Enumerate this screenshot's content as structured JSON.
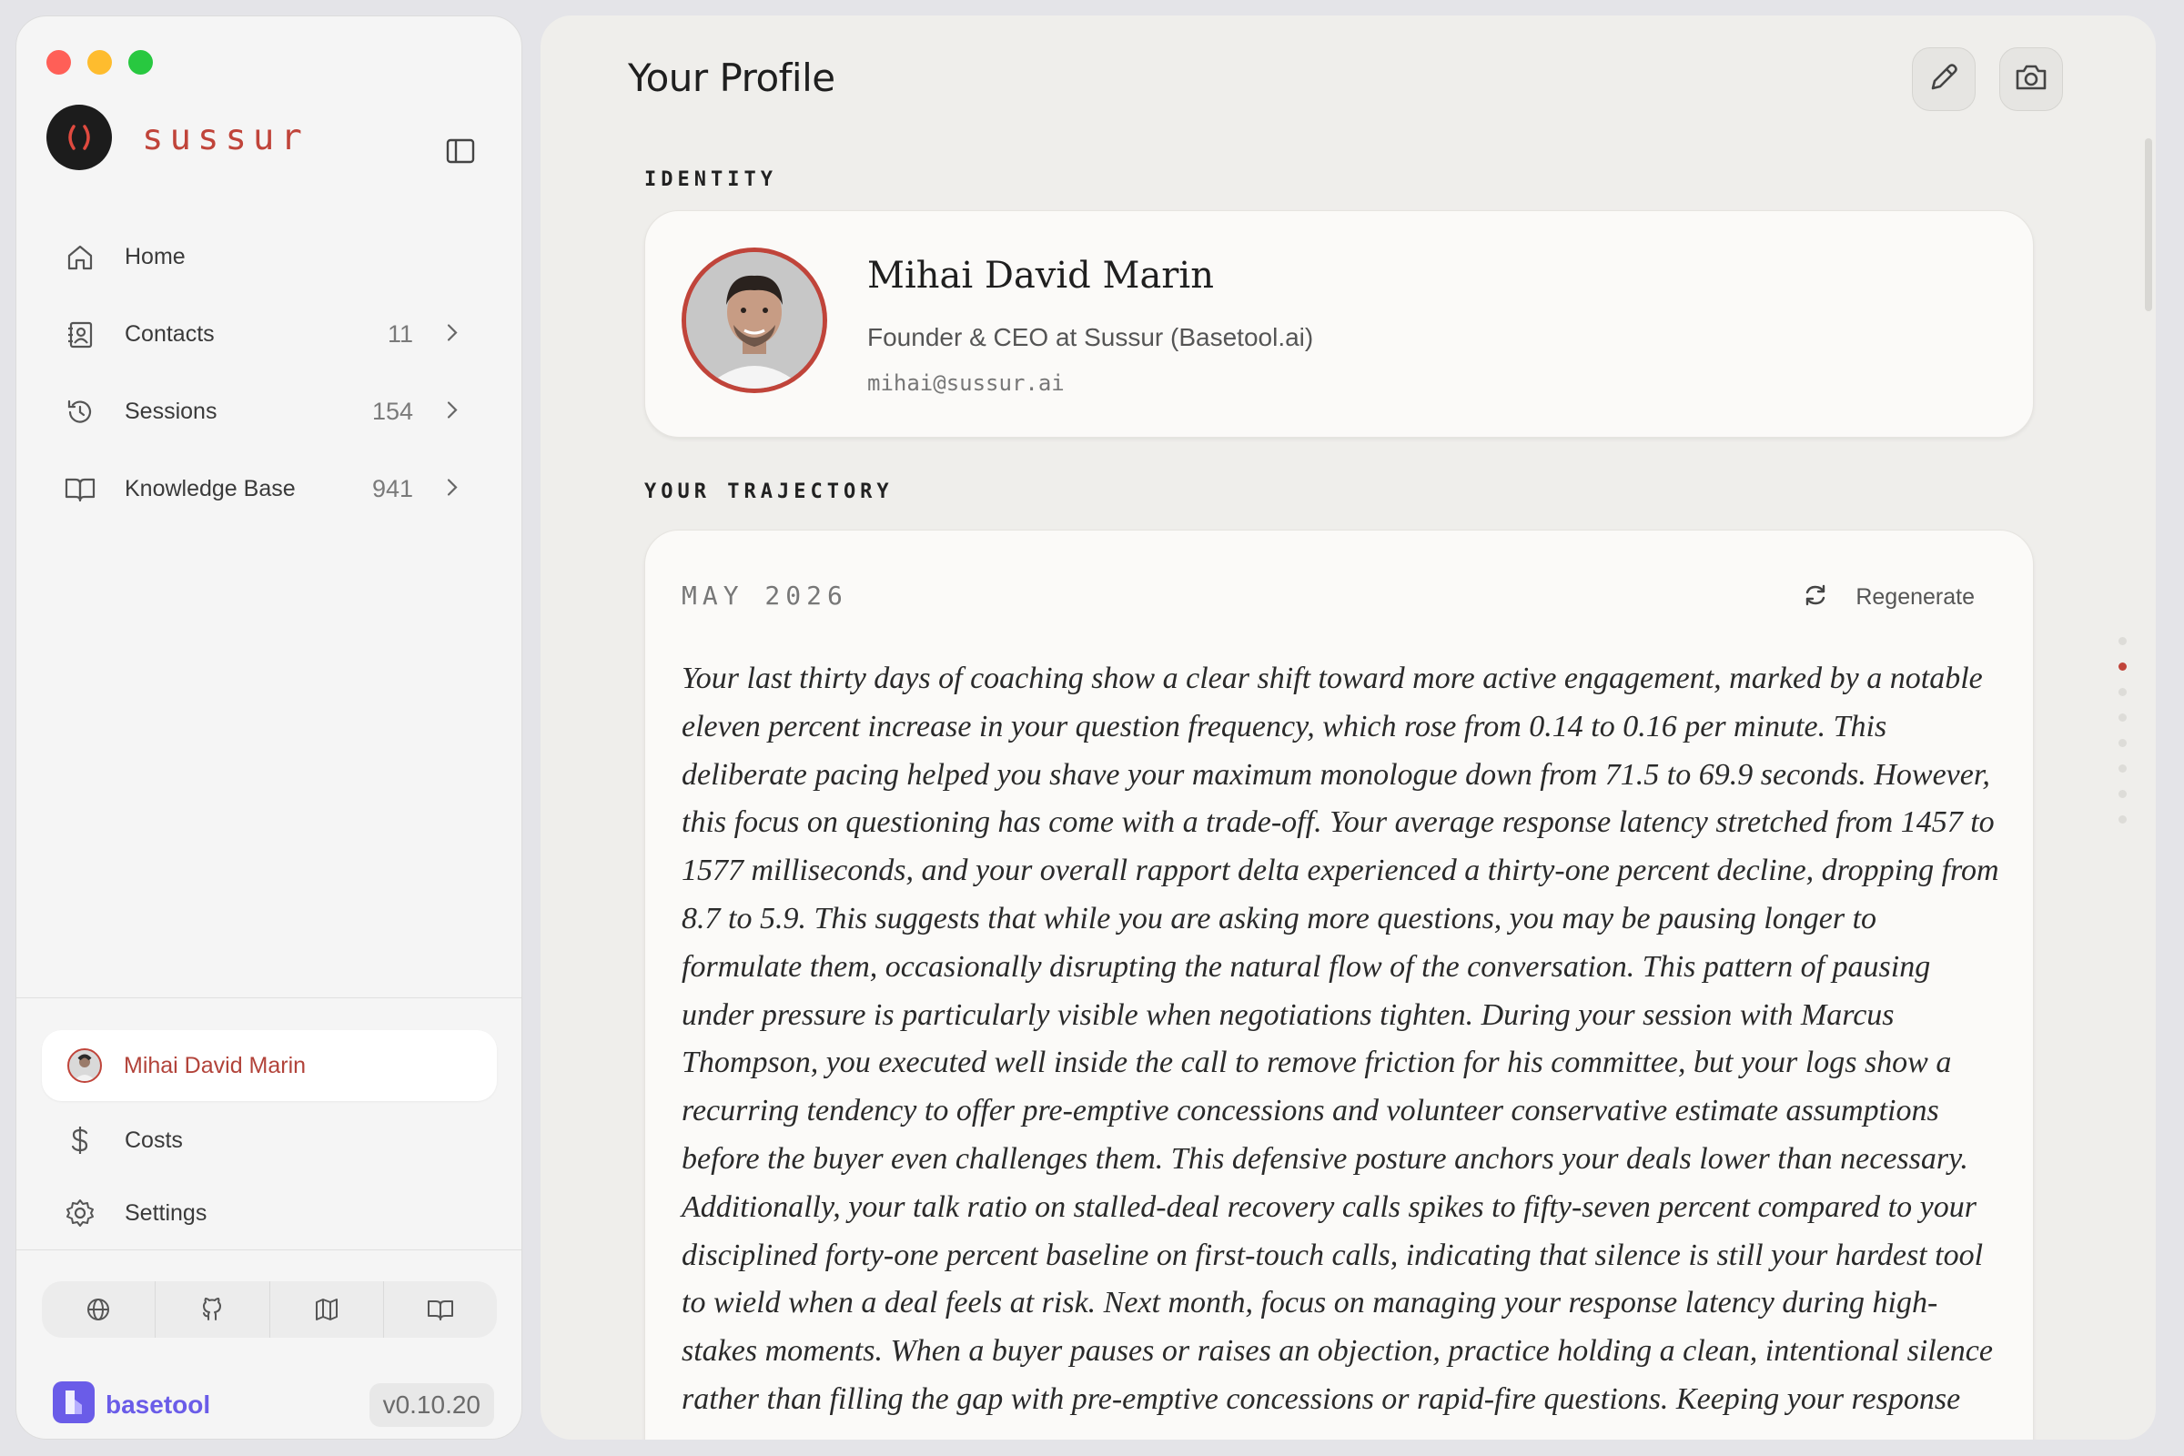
{
  "sidebar": {
    "brand": {
      "name": "sussur",
      "logo_glyph": "( )"
    },
    "nav": [
      {
        "label": "Home",
        "icon": "home-icon"
      },
      {
        "label": "Contacts",
        "count": "11",
        "icon": "contacts-icon"
      },
      {
        "label": "Sessions",
        "count": "154",
        "icon": "history-icon"
      },
      {
        "label": "Knowledge Base",
        "count": "941",
        "icon": "book-icon"
      }
    ],
    "profile": {
      "name": "Mihai David Marin"
    },
    "lower_nav": [
      {
        "label": "Costs",
        "icon": "dollar-icon"
      },
      {
        "label": "Settings",
        "icon": "gear-icon"
      }
    ],
    "icon_bar": [
      "globe-icon",
      "github-icon",
      "map-icon",
      "book-open-icon"
    ],
    "footer": {
      "brand": "basetool",
      "version": "v0.10.20"
    }
  },
  "main": {
    "title": "Your Profile",
    "identity": {
      "section_label": "IDENTITY",
      "name": "Mihai David Marin",
      "role": "Founder & CEO at Sussur (Basetool.ai)",
      "email": "mihai@sussur.ai"
    },
    "trajectory": {
      "section_label": "YOUR TRAJECTORY",
      "date": "MAY 2026",
      "regenerate_label": "Regenerate",
      "text": "Your last thirty days of coaching show a clear shift toward more active engagement, marked by a notable eleven percent increase in your question frequency, which rose from 0.14 to 0.16 per minute. This deliberate pacing helped you shave your maximum monologue down from 71.5 to 69.9 seconds. However, this focus on questioning has come with a trade-off. Your average response latency stretched from 1457 to 1577 milliseconds, and your overall rapport delta experienced a thirty-one percent decline, dropping from 8.7 to 5.9. This suggests that while you are asking more questions, you may be pausing longer to formulate them, occasionally disrupting the natural flow of the conversation. This pattern of pausing under pressure is particularly visible when negotiations tighten. During your session with Marcus Thompson, you executed well inside the call to remove friction for his committee, but your logs show a recurring tendency to offer pre-emptive concessions and volunteer conservative estimate assumptions before the buyer even challenges them. This defensive posture anchors your deals lower than necessary. Additionally, your talk ratio on stalled-deal recovery calls spikes to fifty-seven percent compared to your disciplined forty-one percent baseline on first-touch calls, indicating that silence is still your hardest tool to wield when a deal feels at risk. Next month, focus on managing your response latency during high-stakes moments. When a buyer pauses or raises an objection, practice holding a clean, intentional silence rather than filling the gap with pre-emptive concessions or rapid-fire questions. Keeping your response"
    }
  },
  "colors": {
    "accent": "#c0443a",
    "basetool": "#6a5ce8"
  }
}
